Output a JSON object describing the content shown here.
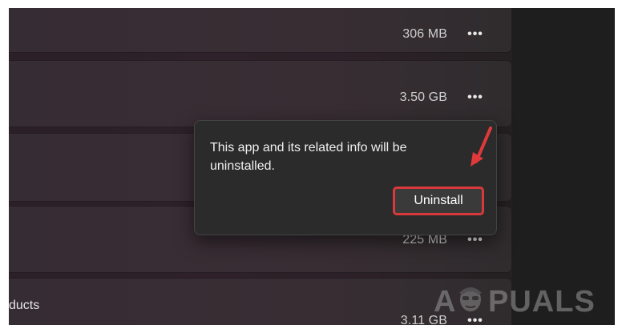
{
  "apps": [
    {
      "name": "",
      "size": "306 MB",
      "more_icon": "more-horizontal-icon"
    },
    {
      "name": "",
      "size": "3.50 GB",
      "more_icon": "more-horizontal-icon"
    },
    {
      "name": "",
      "size": "",
      "more_icon": "more-horizontal-icon"
    },
    {
      "name": "",
      "size": "225 MB",
      "more_icon": "more-horizontal-icon"
    },
    {
      "name": "ducts",
      "size": "3.11 GB",
      "more_icon": "more-horizontal-icon"
    }
  ],
  "more_glyph": "•••",
  "flyout": {
    "message": "This app and its related info will be uninstalled.",
    "uninstall_label": "Uninstall"
  },
  "annotation": {
    "highlight_color": "#d9393a",
    "arrow_color": "#e0393b"
  },
  "watermark": {
    "text_left": "A",
    "text_right": "PUALS"
  }
}
